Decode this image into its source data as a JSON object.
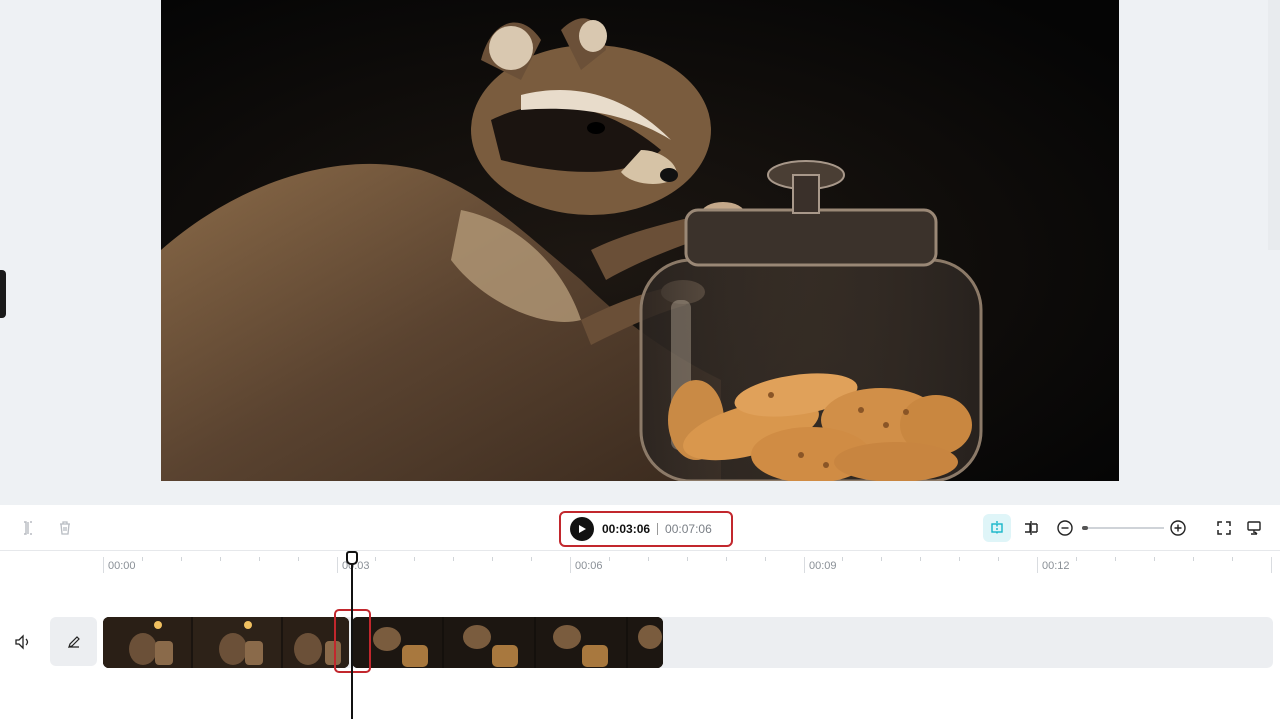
{
  "preview": {
    "scene": "raccoon reaching for cookie jar"
  },
  "toolbar": {
    "current_time": "00:03:06",
    "total_time": "00:07:06",
    "icons": [
      "split-icon",
      "delete-icon",
      "play-icon",
      "snap-icon",
      "split-center-icon",
      "zoom-out-icon",
      "zoom-in-icon",
      "fullscreen-icon",
      "display-icon"
    ],
    "accent_color": "#c2272d",
    "snap_color": "#17b6c9"
  },
  "timeline": {
    "ruler_labels": [
      "00:00",
      "00:03",
      "00:06",
      "00:09",
      "00:12"
    ],
    "track_icons": [
      "volume-icon",
      "edit-icon"
    ]
  }
}
